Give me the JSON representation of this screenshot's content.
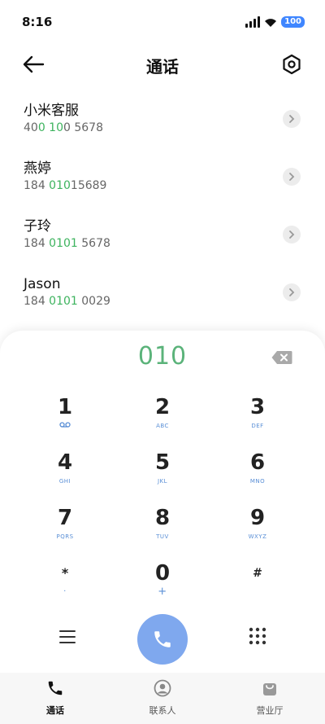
{
  "status": {
    "time": "8:16",
    "battery": "100"
  },
  "header": {
    "title": "通话"
  },
  "contacts": [
    {
      "name": "小米客服",
      "num_pre": "40",
      "num_hl": "0 10",
      "num_post": "0 5678"
    },
    {
      "name": "燕婷",
      "num_pre": "184 ",
      "num_hl": "010",
      "num_post": "15689"
    },
    {
      "name": "子玲",
      "num_pre": "184 ",
      "num_hl": "0101",
      "num_post": " 5678"
    },
    {
      "name": "Jason",
      "num_pre": "184 ",
      "num_hl": "0101",
      "num_post": " 0029"
    }
  ],
  "dialer": {
    "display": "010",
    "keys": [
      {
        "digit": "1",
        "sub": "voicemail-icon"
      },
      {
        "digit": "2",
        "sub": "ABC"
      },
      {
        "digit": "3",
        "sub": "DEF"
      },
      {
        "digit": "4",
        "sub": "GHI"
      },
      {
        "digit": "5",
        "sub": "JKL"
      },
      {
        "digit": "6",
        "sub": "MNO"
      },
      {
        "digit": "7",
        "sub": "PQRS"
      },
      {
        "digit": "8",
        "sub": "TUV"
      },
      {
        "digit": "9",
        "sub": "WXYZ"
      },
      {
        "digit": "*",
        "sub": "·"
      },
      {
        "digit": "0",
        "sub": "+"
      },
      {
        "digit": "#",
        "sub": ""
      }
    ]
  },
  "nav": {
    "calls": "通话",
    "contacts": "联系人",
    "service": "营业厅"
  },
  "colors": {
    "accent": "#7fa8ee",
    "match": "#3db35e"
  }
}
